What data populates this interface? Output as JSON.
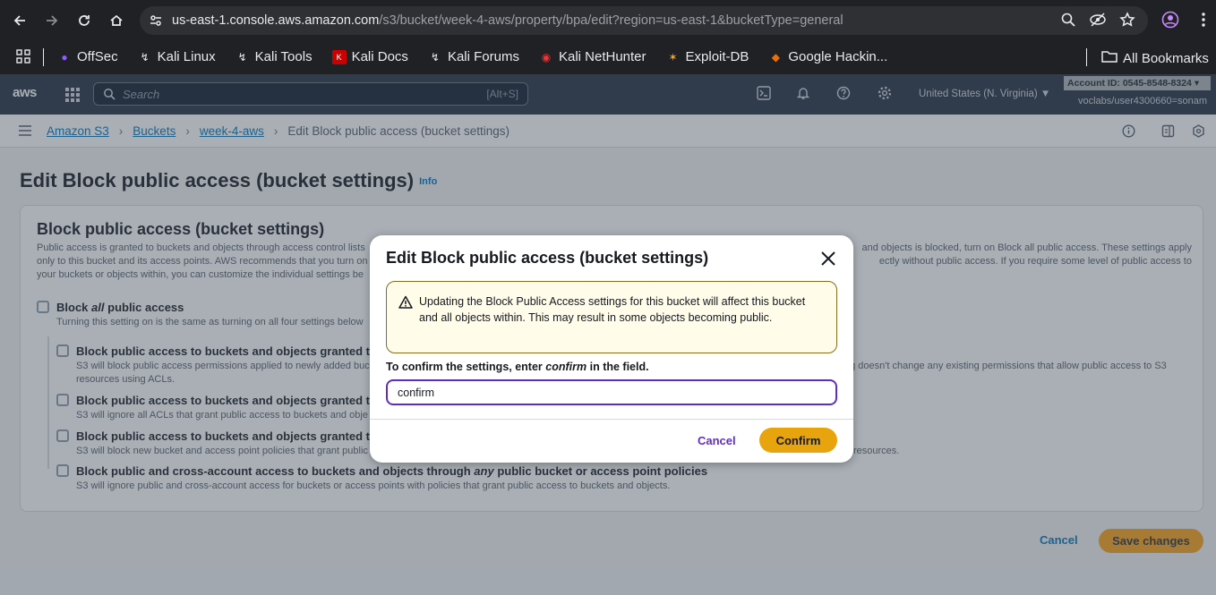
{
  "browser": {
    "url_host": "us-east-1.console.aws.amazon.com",
    "url_path": "/s3/bucket/week-4-aws/property/bpa/edit?region=us-east-1&bucketType=general",
    "bookmarks": [
      "OffSec",
      "Kali Linux",
      "Kali Tools",
      "Kali Docs",
      "Kali Forums",
      "Kali NetHunter",
      "Exploit-DB",
      "Google Hackin..."
    ],
    "all_bookmarks": "All Bookmarks"
  },
  "aws_header": {
    "logo": "aws",
    "search_placeholder": "Search",
    "search_shortcut": "[Alt+S]",
    "region": "United States (N. Virginia) ▼",
    "account": "Account ID: 0545-8548-8324 ▾",
    "user": "voclabs/user4300660=sonam"
  },
  "breadcrumb": {
    "items": [
      "Amazon S3",
      "Buckets",
      "week-4-aws"
    ],
    "current": "Edit Block public access (bucket settings)"
  },
  "page": {
    "title": "Edit Block public access (bucket settings)",
    "info": "Info",
    "panel_title": "Block public access (bucket settings)",
    "panel_desc_left": "Public access is granted to buckets and objects through access control lists",
    "panel_desc_right": "and objects is blocked, turn on Block all public access. These settings apply",
    "panel_desc2_left": "only to this bucket and its access points. AWS recommends that you turn on",
    "panel_desc2_right": "ectly without public access. If you require some level of public access to",
    "panel_desc3_left": "your buckets or objects within, you can customize the individual settings be",
    "block_all_prefix": "Block",
    "block_all_em": "all",
    "block_all_suffix": "public access",
    "block_all_desc": "Turning this setting on is the same as turning on all four settings below",
    "opt1_title": "Block public access to buckets and objects granted thro",
    "opt1_desc": "S3 will block public access permissions applied to newly added buc",
    "opt1_desc_right": "ng doesn't change any existing permissions that allow public access to S3",
    "opt1_desc2": "resources using ACLs.",
    "opt2_title": "Block public access to buckets and objects granted thro",
    "opt2_desc": "S3 will ignore all ACLs that grant public access to buckets and obje",
    "opt3_title": "Block public access to buckets and objects granted thro",
    "opt3_desc": "S3 will block new bucket and access point policies that grant public",
    "opt3_desc_right": "resources.",
    "opt4_title_a": "Block public and cross-account access to buckets and objects through",
    "opt4_title_em": "any",
    "opt4_title_b": "public bucket or access point policies",
    "opt4_desc": "S3 will ignore public and cross-account access for buckets or access points with policies that grant public access to buckets and objects.",
    "cancel": "Cancel",
    "save": "Save changes"
  },
  "modal": {
    "title": "Edit Block public access (bucket settings)",
    "warning": "Updating the Block Public Access settings for this bucket will affect this bucket and all objects within. This may result in some objects becoming public.",
    "confirm_label_a": "To confirm the settings, enter",
    "confirm_label_em": "confirm",
    "confirm_label_b": "in the field.",
    "input_value": "confirm",
    "cancel": "Cancel",
    "confirm": "Confirm"
  }
}
